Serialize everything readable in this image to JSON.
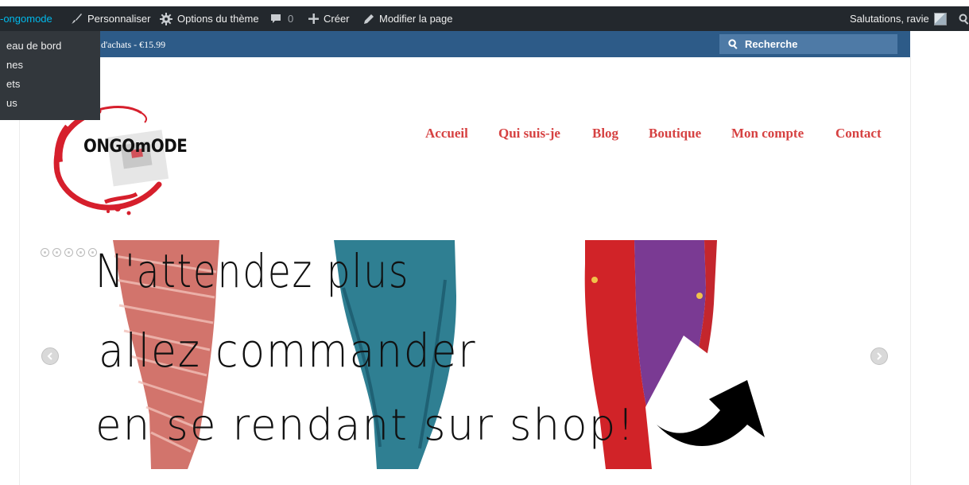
{
  "admin_bar": {
    "site_name": "-ongomode",
    "customize": "Personnaliser",
    "theme_options": "Options du thème",
    "comments_count": "0",
    "create": "Créer",
    "edit_page": "Modifier la page",
    "greeting": "Salutations, ravie"
  },
  "site_dropdown": {
    "items": [
      "eau de bord",
      "nes",
      "ets",
      "us"
    ]
  },
  "header_strip": {
    "cart_text": "d'achats - €15.99",
    "search_placeholder": "Recherche"
  },
  "logo": {
    "text": "ONGOmODE"
  },
  "main_nav": {
    "items": [
      "Accueil",
      "Qui suis-je",
      "Blog",
      "Boutique",
      "Mon compte",
      "Contact"
    ]
  },
  "slider": {
    "lines": [
      "N'attendez plus",
      "allez commander",
      "en se rendant sur shop!"
    ],
    "dot_count": 5,
    "prev_icon": "chevron-left-icon",
    "next_icon": "chevron-right-icon"
  },
  "colors": {
    "admin_bar_bg": "#23282d",
    "site_name": "#00b9eb",
    "header_strip_bg": "#2d5b88",
    "nav_link": "#d64141",
    "logo_splash": "#d61f2c"
  }
}
